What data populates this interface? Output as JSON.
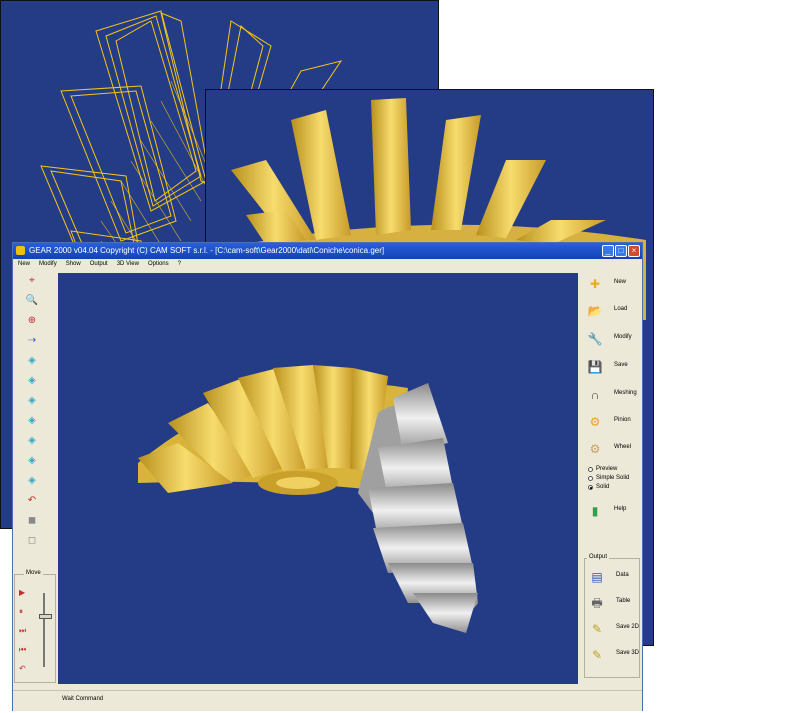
{
  "app": {
    "title": "GEAR 2000 v04.04     Copyright (C)  CAM SOFT s.r.l. - [C:\\cam-soft\\Gear2000\\dati\\Coniche\\conica.ger]",
    "window_controls": [
      "minimize",
      "maximize",
      "close"
    ]
  },
  "menu": [
    "New",
    "Modify",
    "Show",
    "Output",
    "3D View",
    "Options",
    "?"
  ],
  "left_toolbar": [
    {
      "name": "center-icon",
      "glyph": "⌖"
    },
    {
      "name": "zoom-in-icon",
      "glyph": "🔍"
    },
    {
      "name": "zoom-window-icon",
      "glyph": "⊕"
    },
    {
      "name": "pan-icon",
      "glyph": "⇢"
    },
    {
      "name": "view-iso-icon",
      "glyph": "◈"
    },
    {
      "name": "view-top-icon",
      "glyph": "◈"
    },
    {
      "name": "view-front-icon",
      "glyph": "◈"
    },
    {
      "name": "view-side-icon",
      "glyph": "◈"
    },
    {
      "name": "view-right-icon",
      "glyph": "◈"
    },
    {
      "name": "view-back-icon",
      "glyph": "◈"
    },
    {
      "name": "view-rotate-icon",
      "glyph": "◈"
    },
    {
      "name": "undo-view-icon",
      "glyph": "↶"
    },
    {
      "name": "solid-box-icon",
      "glyph": "◼"
    },
    {
      "name": "wire-box-icon",
      "glyph": "◻"
    }
  ],
  "move": {
    "label": "Move",
    "buttons": [
      {
        "name": "play-icon",
        "glyph": "▶"
      },
      {
        "name": "pause-icon",
        "glyph": "⏸"
      },
      {
        "name": "step-forward-icon",
        "glyph": "⏭"
      },
      {
        "name": "step-back-icon",
        "glyph": "⏮"
      },
      {
        "name": "return-icon",
        "glyph": "↶"
      }
    ]
  },
  "right_toolbar": [
    {
      "label": "New",
      "icon": "new-folder-icon",
      "glyph": "✚",
      "color": "#e8b020"
    },
    {
      "label": "Load",
      "icon": "load-folder-icon",
      "glyph": "📂",
      "color": "#e8c040"
    },
    {
      "label": "Modify",
      "icon": "wrench-icon",
      "glyph": "🔧",
      "color": "#5a8ad8"
    },
    {
      "label": "Save",
      "icon": "floppy-disk-icon",
      "glyph": "💾",
      "color": "#304a9a"
    },
    {
      "label": "Meshing",
      "icon": "meshing-curve-icon",
      "glyph": "∩",
      "color": "#444444"
    },
    {
      "label": "Pinion",
      "icon": "pinion-gear-icon",
      "glyph": "⚙",
      "color": "#f0a020"
    },
    {
      "label": "Wheel",
      "icon": "wheel-gear-icon",
      "glyph": "⚙",
      "color": "#c8a060"
    }
  ],
  "display_mode": {
    "options": [
      "Preview",
      "Simple Solid",
      "Solid"
    ],
    "selected": "Solid"
  },
  "help": {
    "label": "Help",
    "icon": "help-chart-icon",
    "glyph": "▮",
    "color": "#30a050"
  },
  "output": {
    "label": "Output",
    "buttons": [
      {
        "label": "Data",
        "icon": "data-icon",
        "glyph": "▤",
        "color": "#3050c0"
      },
      {
        "label": "Table",
        "icon": "printer-icon",
        "glyph": "🖶",
        "color": "#666666"
      },
      {
        "label": "Save 2D",
        "icon": "save-2d-icon",
        "glyph": "✎",
        "color": "#c0a020"
      },
      {
        "label": "Save 3D",
        "icon": "save-3d-icon",
        "glyph": "✎",
        "color": "#c0a020"
      }
    ]
  },
  "status": {
    "text": "Wait Command"
  },
  "colors": {
    "viewport_bg": "#243c86",
    "gear_gold": "#e8c040",
    "gear_silver": "#b8b8b8",
    "wire_gold": "#f5c518",
    "titlebar": "#1e52cc",
    "window_bg": "#ece9d8"
  }
}
